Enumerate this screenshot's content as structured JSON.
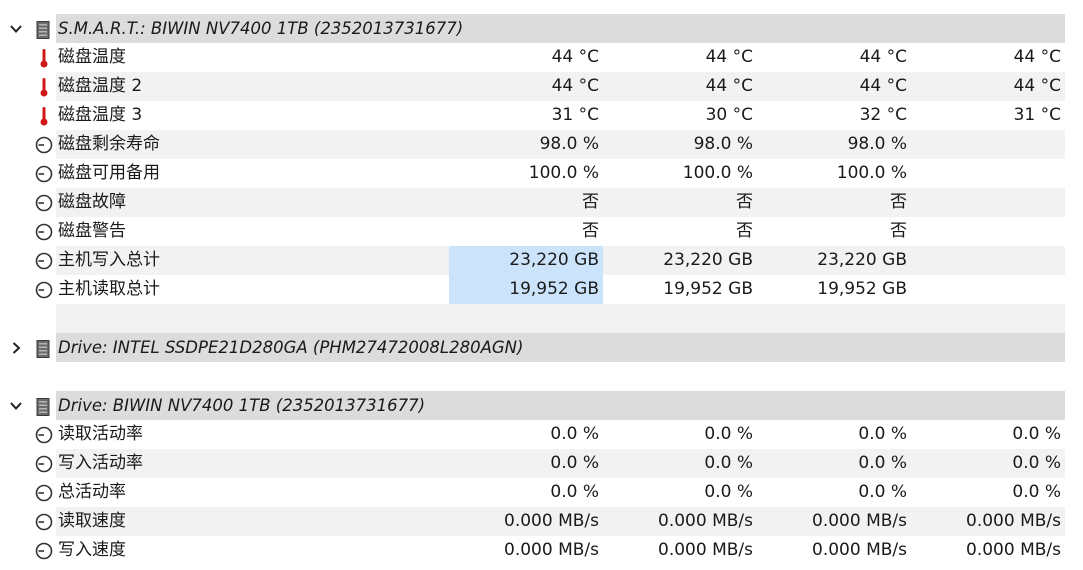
{
  "sections": [
    {
      "title": "S.M.A.R.T.: BIWIN NV7400 1TB (2352013731677)",
      "expanded": true,
      "rows": [
        {
          "icon": "thermometer-icon",
          "label": "磁盘温度",
          "values": [
            "44 °C",
            "44 °C",
            "44 °C",
            "44 °C"
          ]
        },
        {
          "icon": "thermometer-icon",
          "label": "磁盘温度 2",
          "values": [
            "44 °C",
            "44 °C",
            "44 °C",
            "44 °C"
          ]
        },
        {
          "icon": "thermometer-icon",
          "label": "磁盘温度 3",
          "values": [
            "31 °C",
            "30 °C",
            "32 °C",
            "31 °C"
          ]
        },
        {
          "icon": "clock-icon",
          "label": "磁盘剩余寿命",
          "values": [
            "98.0 %",
            "98.0 %",
            "98.0 %",
            ""
          ]
        },
        {
          "icon": "clock-icon",
          "label": "磁盘可用备用",
          "values": [
            "100.0 %",
            "100.0 %",
            "100.0 %",
            ""
          ]
        },
        {
          "icon": "clock-icon",
          "label": "磁盘故障",
          "values": [
            "否",
            "否",
            "否",
            ""
          ]
        },
        {
          "icon": "clock-icon",
          "label": "磁盘警告",
          "values": [
            "否",
            "否",
            "否",
            ""
          ]
        },
        {
          "icon": "clock-icon",
          "label": "主机写入总计",
          "values": [
            "23,220 GB",
            "23,220 GB",
            "23,220 GB",
            ""
          ],
          "selected_col": 0
        },
        {
          "icon": "clock-icon",
          "label": "主机读取总计",
          "values": [
            "19,952 GB",
            "19,952 GB",
            "19,952 GB",
            ""
          ],
          "selected_col": 0
        }
      ]
    },
    {
      "title": "Drive: INTEL SSDPE21D280GA (PHM27472008L280AGN)",
      "expanded": false,
      "rows": []
    },
    {
      "title": "Drive: BIWIN NV7400 1TB (2352013731677)",
      "expanded": true,
      "rows": [
        {
          "icon": "clock-icon",
          "label": "读取活动率",
          "values": [
            "0.0 %",
            "0.0 %",
            "0.0 %",
            "0.0 %"
          ]
        },
        {
          "icon": "clock-icon",
          "label": "写入活动率",
          "values": [
            "0.0 %",
            "0.0 %",
            "0.0 %",
            "0.0 %"
          ]
        },
        {
          "icon": "clock-icon",
          "label": "总活动率",
          "values": [
            "0.0 %",
            "0.0 %",
            "0.0 %",
            "0.0 %"
          ]
        },
        {
          "icon": "clock-icon",
          "label": "读取速度",
          "values": [
            "0.000 MB/s",
            "0.000 MB/s",
            "0.000 MB/s",
            "0.000 MB/s"
          ]
        },
        {
          "icon": "clock-icon",
          "label": "写入速度",
          "values": [
            "0.000 MB/s",
            "0.000 MB/s",
            "0.000 MB/s",
            "0.000 MB/s"
          ]
        }
      ]
    }
  ],
  "colors": {
    "header_bg": "#dcdcdc",
    "alt_row_bg": "#f2f2f2",
    "selection_bg": "#cce4fb",
    "thermometer_red": "#d01818"
  }
}
